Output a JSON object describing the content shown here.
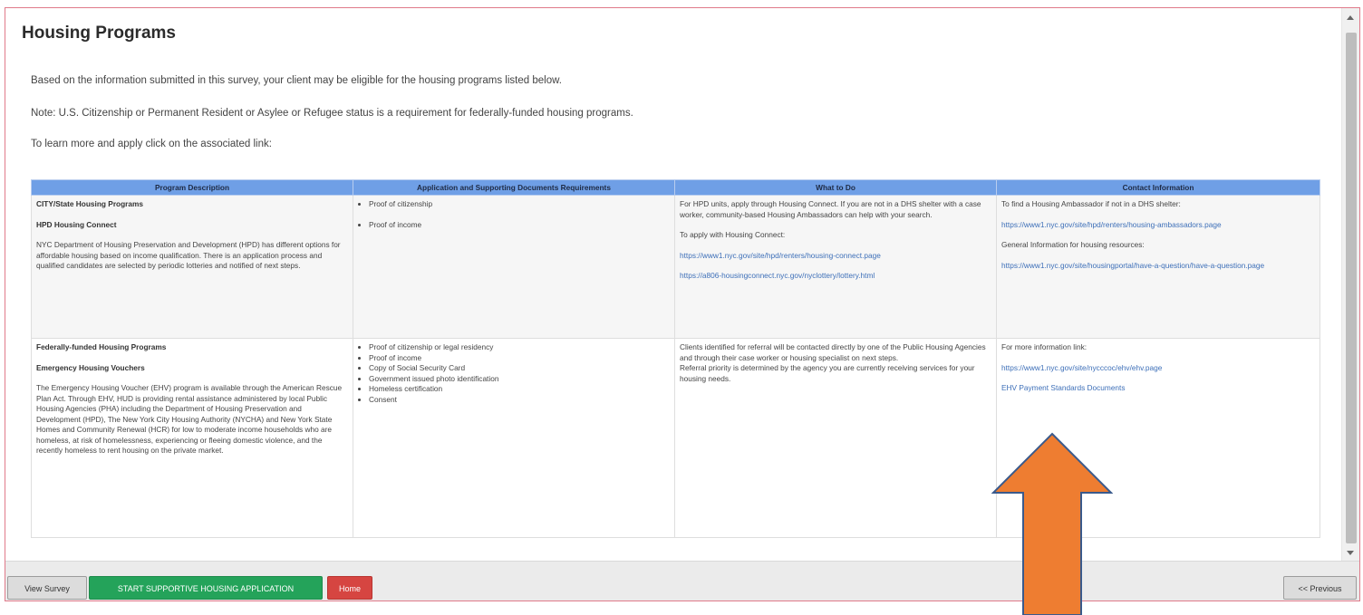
{
  "page": {
    "title": "Housing Programs",
    "intro_eligibility": "Based on the information submitted in this survey, your client may be eligible for the housing programs listed below.",
    "intro_note": "Note: U.S. Citizenship or Permanent Resident or Asylee or Refugee status is a requirement for federally-funded housing programs.",
    "intro_learn": "To learn more and apply click on the associated link:"
  },
  "table": {
    "headers": [
      "Program Description",
      "Application and Supporting Documents Requirements",
      "What to Do",
      "Contact Information"
    ],
    "rows": [
      {
        "program_category": "CITY/State Housing Programs",
        "program_name": "HPD Housing Connect",
        "program_description": "NYC Department of Housing Preservation and Development (HPD) has different options for affordable housing based on income qualification. There is an application process and qualified candidates are selected by periodic lotteries and notified of next steps.",
        "requirements": [
          "Proof of citizenship",
          "Proof of income"
        ],
        "what_to_do_text": "For HPD units, apply through Housing Connect. If you are not in a DHS shelter with a case worker, community-based Housing Ambassadors can help with your search.",
        "what_to_do_apply": "To apply with Housing Connect:",
        "what_to_do_links": [
          "https://www1.nyc.gov/site/hpd/renters/housing-connect.page",
          "https://a806-housingconnect.nyc.gov/nyclottery/lottery.html"
        ],
        "contact_text_1": "To find a Housing Ambassador if not in a DHS shelter:",
        "contact_link_1": "https://www1.nyc.gov/site/hpd/renters/housing-ambassadors.page",
        "contact_text_2": "General Information for housing resources:",
        "contact_link_2": "https://www1.nyc.gov/site/housingportal/have-a-question/have-a-question.page"
      },
      {
        "program_category": "Federally-funded Housing Programs",
        "program_name": "Emergency Housing Vouchers",
        "program_description": "The Emergency Housing Voucher (EHV) program is available through the American Rescue Plan Act. Through EHV, HUD is providing rental assistance administered by local Public Housing Agencies (PHA) including the Department of Housing Preservation and Development (HPD), The New York City Housing Authority (NYCHA) and New York State Homes and Community Renewal (HCR) for low to moderate income households who are homeless, at risk of homelessness, experiencing or fleeing domestic violence, and the recently homeless to rent housing on the private market.",
        "requirements": [
          "Proof of citizenship or legal residency",
          "Proof of income",
          "Copy of Social Security Card",
          "Government issued photo identification",
          "Homeless certification",
          "Consent"
        ],
        "what_to_do_text": "Clients identified for referral will be contacted directly by one of the Public Housing Agencies and through their case worker or housing specialist on next steps.",
        "what_to_do_referral": "Referral priority is determined by the agency you are currently receiving services for your housing needs.",
        "contact_text_1": "For more information link:",
        "contact_link_1": "https://www1.nyc.gov/site/nycccoc/ehv/ehv.page",
        "contact_link_2": "EHV Payment Standards Documents"
      }
    ]
  },
  "footer": {
    "view_survey": "View Survey",
    "start_application": "START SUPPORTIVE HOUSING APPLICATION",
    "home": "Home",
    "previous": "<< Previous"
  },
  "colors": {
    "table_header": "#6f9fe6",
    "link": "#3d6fb8",
    "start_button": "#24a35a",
    "home_button": "#d64541",
    "annotation_arrow": "#ee7d31",
    "frame_border": "#e07a8a"
  },
  "icons": {
    "annotation": "up-arrow-icon",
    "scroll_up": "scroll-up-arrow-icon",
    "scroll_down": "scroll-down-arrow-icon"
  }
}
